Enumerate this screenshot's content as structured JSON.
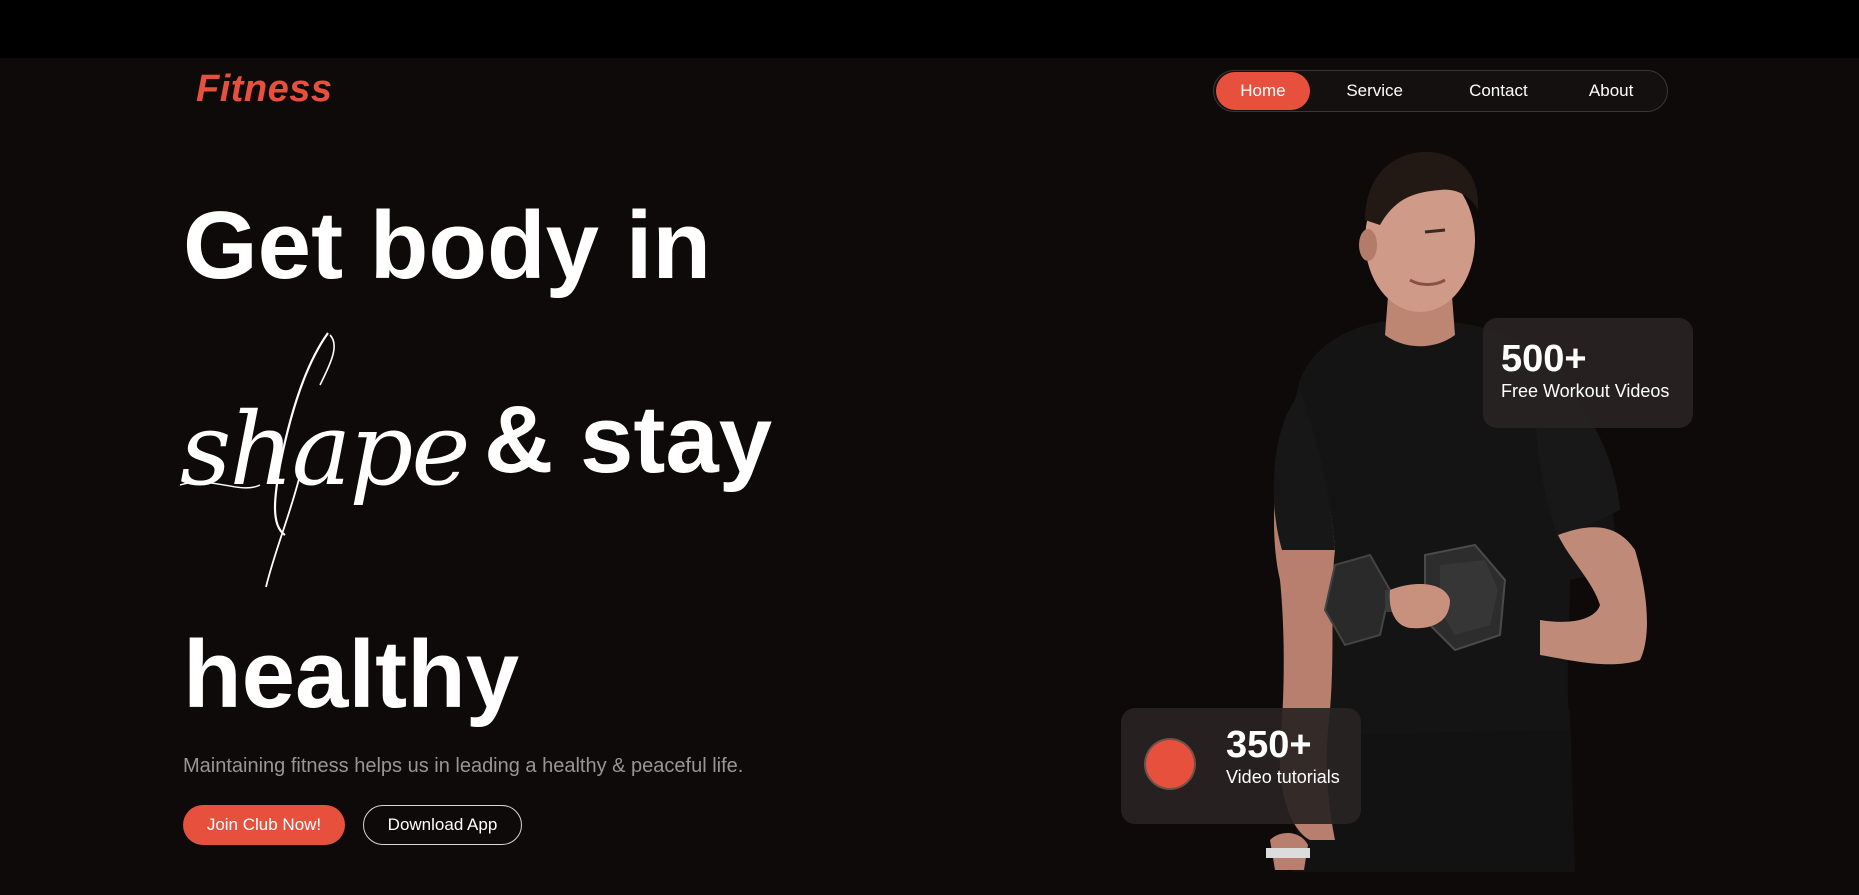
{
  "brand": {
    "logo_text": "Fitness",
    "accent_color": "#e8503e",
    "background_color": "#0e0a09"
  },
  "nav": {
    "items": [
      {
        "label": "Home",
        "active": true
      },
      {
        "label": "Service",
        "active": false
      },
      {
        "label": "Contact",
        "active": false
      },
      {
        "label": "About",
        "active": false
      }
    ]
  },
  "hero": {
    "line1": "Get body in",
    "script_word": "shape",
    "line2_rest": "& stay",
    "line3": "healthy",
    "subtitle": "Maintaining fitness helps us in leading a healthy & peaceful life.",
    "primary_button": "Join Club Now!",
    "secondary_button": "Download App",
    "image_subject": "man-with-dumbbell"
  },
  "stats": [
    {
      "value": "500+",
      "label": "Free Workout Videos"
    },
    {
      "value": "350+",
      "label": "Video tutorials",
      "icon": "record-dot-icon"
    }
  ]
}
